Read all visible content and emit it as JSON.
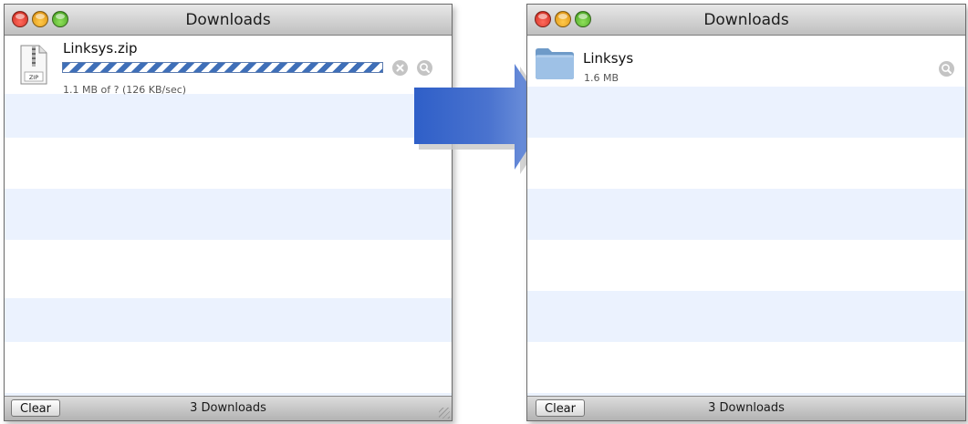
{
  "downloading_window": {
    "title": "Downloads",
    "item": {
      "file_name": "Linksys.zip",
      "icon_label": "ZIP",
      "status": "1.1 MB of ? (126 KB/sec)"
    },
    "clear_label": "Clear",
    "count_label": "3 Downloads"
  },
  "completed_window": {
    "title": "Downloads",
    "item": {
      "file_name": "Linksys",
      "size": "1.6 MB"
    },
    "clear_label": "Clear",
    "count_label": "3 Downloads"
  },
  "colors": {
    "row_stripe": "#ebf2fe",
    "progress_blue": "#3f6fb8",
    "arrow_blue": "#2f5fc8"
  }
}
